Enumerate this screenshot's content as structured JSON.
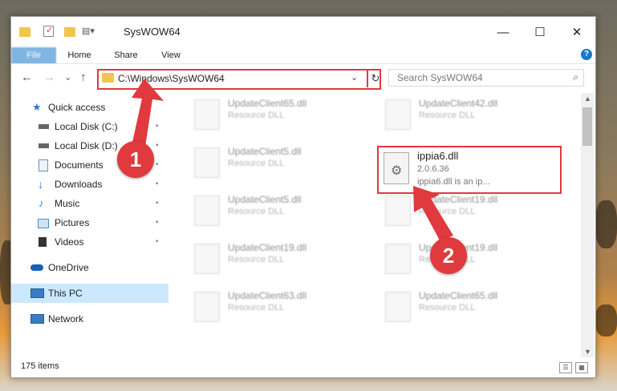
{
  "window": {
    "title": "SysWOW64",
    "controls": {
      "minimize": "—",
      "maximize": "☐",
      "close": "✕"
    }
  },
  "ribbon": {
    "tabs": [
      "File",
      "Home",
      "Share",
      "View"
    ],
    "help_label": "?"
  },
  "nav": {
    "back": "←",
    "forward": "→",
    "recent": "⌄",
    "up": "↑",
    "address": "C:\\Windows\\SysWOW64",
    "dropdown": "⌄",
    "refresh": "↻"
  },
  "search": {
    "placeholder": "Search SysWOW64",
    "icon": "⌕"
  },
  "sidebar": {
    "items": [
      {
        "label": "Quick access",
        "icon": "star-icon",
        "color": "#2b7bd6"
      },
      {
        "label": "Local Disk (C:)",
        "icon": "drive-icon",
        "color": "#555555",
        "pinned": true
      },
      {
        "label": "Local Disk (D:)",
        "icon": "drive-icon",
        "color": "#555555",
        "pinned": true
      },
      {
        "label": "Documents",
        "icon": "documents-icon",
        "color": "#6b8fc2",
        "pinned": true
      },
      {
        "label": "Downloads",
        "icon": "download-icon",
        "color": "#2b7bd6",
        "pinned": true
      },
      {
        "label": "Music",
        "icon": "music-icon",
        "color": "#2b7bd6",
        "pinned": true
      },
      {
        "label": "Pictures",
        "icon": "pictures-icon",
        "color": "#4a90c8",
        "pinned": true
      },
      {
        "label": "Videos",
        "icon": "videos-icon",
        "color": "#333333",
        "pinned": true
      },
      {
        "label": "OneDrive",
        "icon": "cloud-icon",
        "color": "#1a5fb4"
      },
      {
        "label": "This PC",
        "icon": "computer-icon",
        "color": "#3a7cc2",
        "selected": true
      },
      {
        "label": "Network",
        "icon": "network-icon",
        "color": "#3a7cc2"
      }
    ],
    "pin_glyph": "📌"
  },
  "files": [
    {
      "name": "UpdateClient65.dll",
      "type": "Resource DLL"
    },
    {
      "name": "UpdateClient42.dll",
      "type": "Resource DLL"
    },
    {
      "name": "UpdateClient5.dll",
      "type": "Resource DLL"
    },
    {
      "name": "UpdateClient5.dll",
      "type": "Resource DLL"
    },
    {
      "name": "UpdateClient19.dll",
      "type": "Resource DLL"
    },
    {
      "name": "UpdateClient19.dll",
      "type": "Resource DLL"
    },
    {
      "name": "UpdateClient19.dll",
      "type": "Resource DLL"
    },
    {
      "name": "UpdateClient63.dll",
      "type": "Resource DLL"
    },
    {
      "name": "UpdateClient65.dll",
      "type": "Resource DLL"
    }
  ],
  "highlighted_file": {
    "name": "ippia6.dll",
    "version": "2.0.6.36",
    "description": "ippia6.dll is an ip..."
  },
  "status": {
    "item_count": "175 items",
    "details_view": "☰",
    "tiles_view": "▦"
  },
  "annotations": {
    "step1": "1",
    "step2": "2",
    "color": "#e0393e"
  }
}
